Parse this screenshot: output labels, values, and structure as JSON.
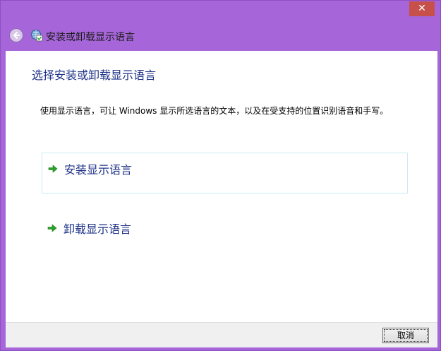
{
  "window": {
    "title": "安装或卸载显示语言",
    "close_glyph": "✕"
  },
  "main": {
    "heading": "选择安装或卸载显示语言",
    "description": "使用显示语言，可让 Windows 显示所选语言的文本，以及在受支持的位置识别语音和手写。",
    "options": [
      {
        "label": "安装显示语言",
        "icon": "green-arrow-icon"
      },
      {
        "label": "卸载显示语言",
        "icon": "green-arrow-icon"
      }
    ]
  },
  "footer": {
    "cancel_label": "取消"
  },
  "colors": {
    "frame": "#a666d9",
    "link_text": "#1e3287",
    "arrow": "#2aa12a",
    "close_bg": "#c7504a"
  }
}
